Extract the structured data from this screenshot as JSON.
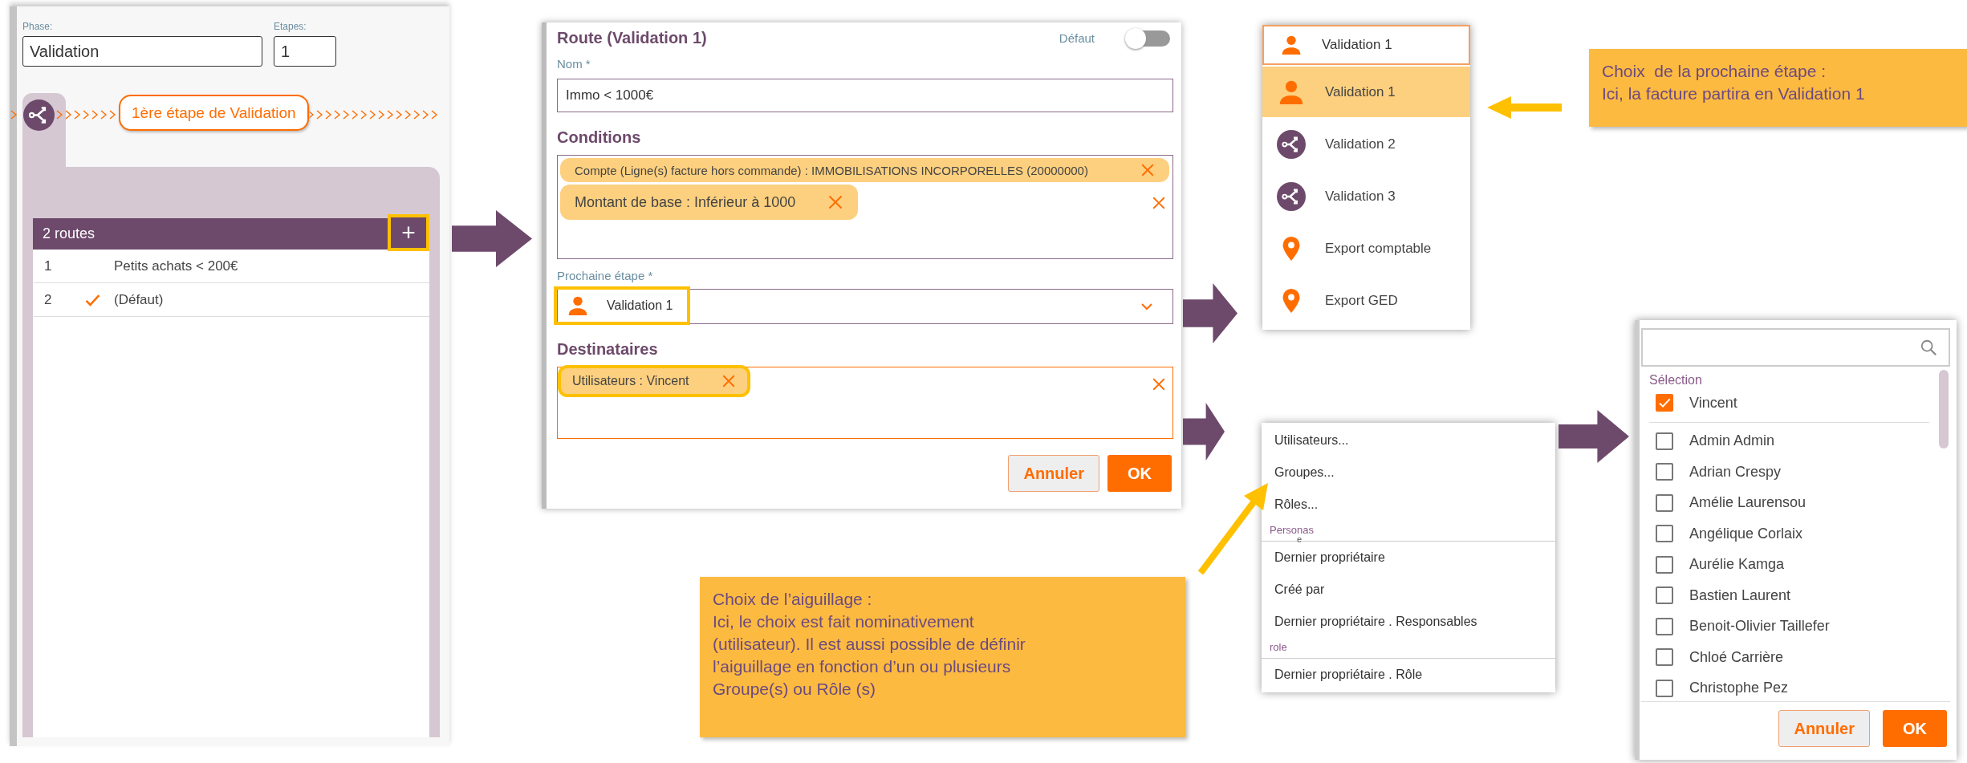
{
  "phase_panel": {
    "phase_label": "Phase:",
    "phase_value": "Validation",
    "steps_label": "Etapes:",
    "steps_value": "1",
    "step_badge": "1ère étape de Validation",
    "routes_count": "2 routes",
    "add_button": {
      "label": "+",
      "highlighted": true
    },
    "routes": [
      {
        "number": "1",
        "default": false,
        "name": "Petits achats < 200€"
      },
      {
        "number": "2",
        "default": true,
        "name": "(Défaut)"
      }
    ]
  },
  "route_dialog": {
    "title": "Route (Validation 1)",
    "default_label": "Défaut",
    "default_on": false,
    "name_label": "Nom *",
    "name_value": "Immo < 1000€",
    "conditions_label": "Conditions",
    "conditions": [
      {
        "text": "Compte (Ligne(s) facture hors commande) : IMMOBILISATIONS INCORPORELLES (20000000)"
      },
      {
        "text": "Montant de base : Inférieur à 1000"
      }
    ],
    "next_step_label": "Prochaine étape *",
    "next_step": {
      "kind": "user",
      "text": "Validation 1",
      "highlighted": true
    },
    "recipients_label": "Destinataires",
    "recipients": [
      {
        "text": "Utilisateurs : Vincent",
        "highlighted": true
      }
    ],
    "buttons": [
      {
        "label": "Annuler",
        "kind": "secondary"
      },
      {
        "label": "OK",
        "kind": "primary"
      }
    ]
  },
  "step_dropdown": {
    "current": {
      "kind": "user",
      "text": "Validation 1"
    },
    "options": [
      {
        "kind": "user",
        "text": "Validation 1",
        "selected": true
      },
      {
        "kind": "branch",
        "text": "Validation 2",
        "selected": false
      },
      {
        "kind": "branch",
        "text": "Validation 3",
        "selected": false
      },
      {
        "kind": "export",
        "text": "Export comptable",
        "selected": false
      },
      {
        "kind": "export",
        "text": "Export GED",
        "selected": false
      }
    ]
  },
  "callouts": [
    {
      "lines": [
        "Choix  de la prochaine étape :",
        "Ici, la facture partira en Validation 1"
      ]
    },
    {
      "lines": [
        "Choix de l’aiguillage :",
        "Ici, le choix est fait nominativement",
        "(utilisateur). Il est aussi possible de définir",
        "l’aiguillage en fonction d’un ou plusieurs",
        "Groupe(s) ou Rôle (s)"
      ]
    }
  ],
  "recipient_menu": {
    "items": [
      {
        "kind": "option",
        "text": "Utilisateurs..."
      },
      {
        "kind": "option",
        "text": "Groupes..."
      },
      {
        "kind": "option",
        "text": "Rôles..."
      },
      {
        "kind": "group",
        "text": "Personas",
        "stray": "e"
      },
      {
        "kind": "option",
        "text": "Dernier propriétaire"
      },
      {
        "kind": "option",
        "text": "Créé par"
      },
      {
        "kind": "option",
        "text": "Dernier propriétaire . Responsables"
      },
      {
        "kind": "group",
        "text": "role"
      },
      {
        "kind": "option",
        "text": "Dernier propriétaire . Rôle"
      }
    ]
  },
  "user_picker": {
    "selection_label": "Sélection",
    "selected_users": [
      {
        "name": "Vincent",
        "checked": true
      }
    ],
    "users": [
      {
        "name": "Admin Admin",
        "checked": false
      },
      {
        "name": "Adrian Crespy",
        "checked": false
      },
      {
        "name": "Amélie Laurensou",
        "checked": false
      },
      {
        "name": "Angélique Corlaix",
        "checked": false
      },
      {
        "name": "Aurélie Kamga",
        "checked": false
      },
      {
        "name": "Bastien Laurent",
        "checked": false
      },
      {
        "name": "Benoit-Olivier Taillefer",
        "checked": false
      },
      {
        "name": "Chloé Carrière",
        "checked": false
      },
      {
        "name": "Christophe Pez",
        "checked": false
      }
    ],
    "buttons": [
      {
        "label": "Annuler",
        "kind": "secondary"
      },
      {
        "label": "OK",
        "kind": "primary"
      }
    ]
  }
}
